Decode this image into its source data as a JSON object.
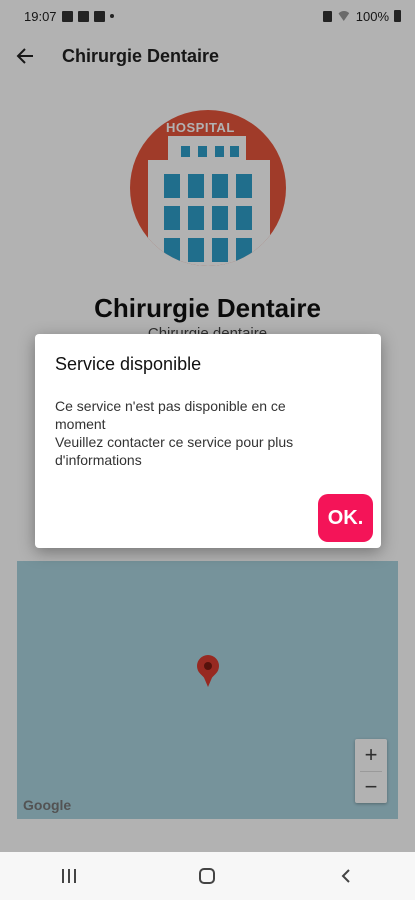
{
  "status_bar": {
    "time": "19:07",
    "battery": "100%"
  },
  "app_bar": {
    "back_icon": "arrow-left-icon",
    "title": "Chirurgie Dentaire"
  },
  "place": {
    "logo_text": "HOSPITAL",
    "name": "Chirurgie Dentaire",
    "subtitle": "Chirurgie dentaire"
  },
  "map": {
    "zoom_in_label": "+",
    "zoom_out_label": "−",
    "attribution": "Google"
  },
  "dialog": {
    "title": "Service disponible",
    "message": "Ce service n'est pas disponible en ce\nmoment\nVeuillez contacter ce service pour plus\nd'informations",
    "ok_label": "OK.",
    "accent_color": "#f41458"
  },
  "nav_bar": {
    "recent_icon": "recent-apps-icon",
    "home_icon": "home-icon",
    "back_icon": "chevron-left-icon"
  }
}
